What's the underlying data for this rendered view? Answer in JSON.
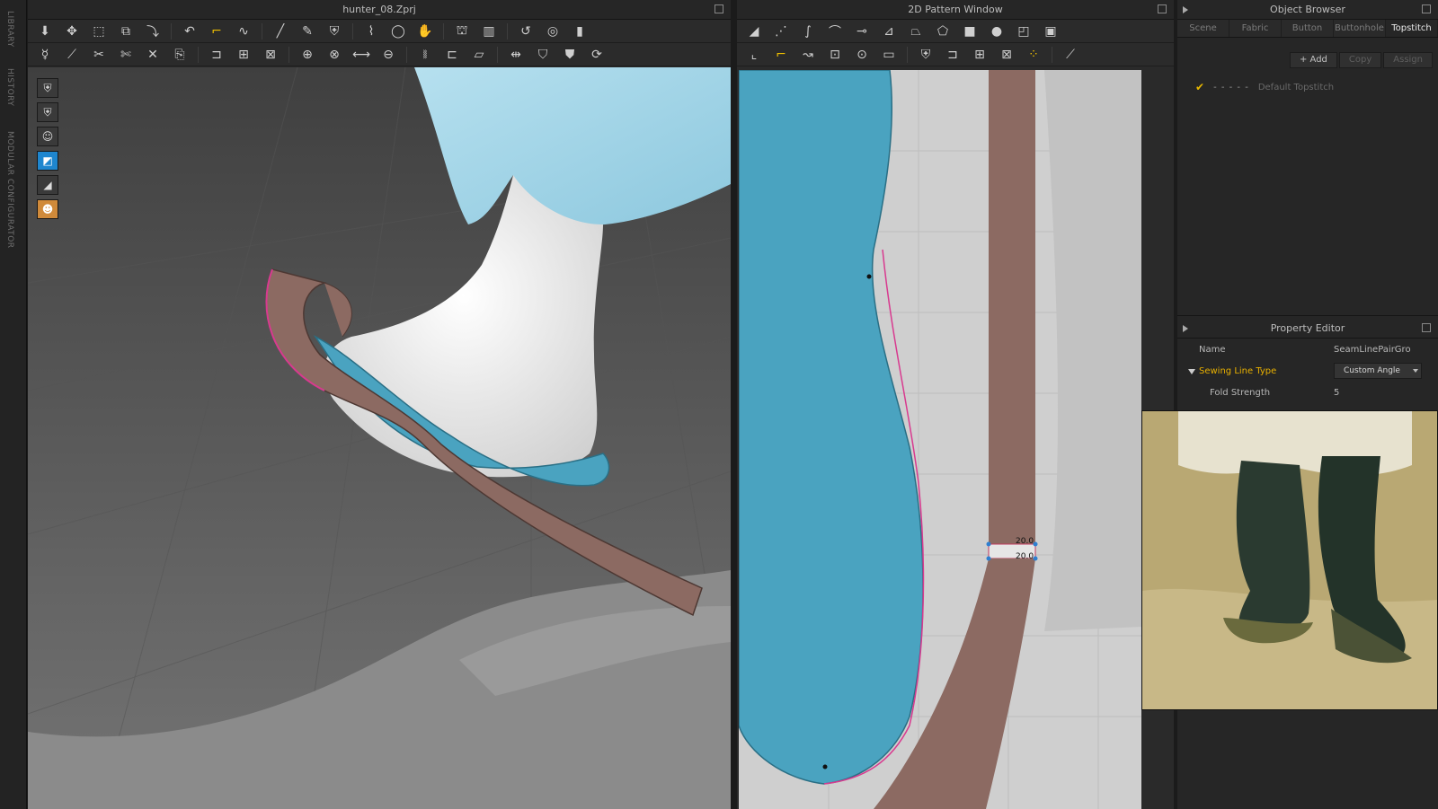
{
  "sidebar_strip": {
    "library": "LIBRARY",
    "history": "HISTORY",
    "modular": "MODULAR CONFIGURATOR"
  },
  "view3d": {
    "title": "hunter_08.Zprj"
  },
  "view2d": {
    "title": "2D Pattern Window",
    "dim_top": "20.0",
    "dim_bottom": "20.0"
  },
  "object_browser": {
    "title": "Object Browser",
    "tabs": [
      "Scene",
      "Fabric",
      "Button",
      "Buttonhole",
      "Topstitch"
    ],
    "active_tab": "Topstitch",
    "buttons": {
      "add": "+ Add",
      "copy": "Copy",
      "assign": "Assign"
    },
    "items": [
      {
        "dashes": "- - - - -",
        "label": "Default Topstitch"
      }
    ]
  },
  "property_editor": {
    "title": "Property Editor",
    "name_key": "Name",
    "name_value": "SeamLinePairGro",
    "section": "Sewing Line Type",
    "section_value": "Custom Angle",
    "fold_key": "Fold Strength",
    "fold_value": "5"
  },
  "colors": {
    "fabric_blue": "#4aa3c0",
    "leather": "#8c6a62",
    "accent": "#e8b000"
  }
}
